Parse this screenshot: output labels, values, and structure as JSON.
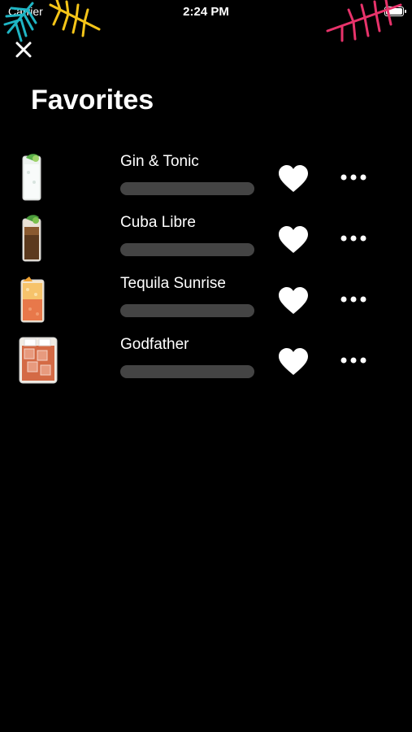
{
  "status": {
    "carrier": "Carrier",
    "time": "2:24 PM"
  },
  "header": {
    "title": "Favorites"
  },
  "favorites": [
    {
      "name": "Gin & Tonic",
      "progress": 0,
      "thumb": "gin-tonic-glass-icon"
    },
    {
      "name": "Cuba Libre",
      "progress": 0,
      "thumb": "cuba-libre-glass-icon"
    },
    {
      "name": "Tequila Sunrise",
      "progress": 0,
      "thumb": "tequila-sunrise-glass-icon"
    },
    {
      "name": "Godfather",
      "progress": 0,
      "thumb": "godfather-glass-icon"
    }
  ],
  "colors": {
    "background": "#000000",
    "bar_track": "#444444",
    "leaf_teal": "#1fb5c4",
    "leaf_yellow": "#f5c518",
    "leaf_pink": "#e8336b"
  }
}
